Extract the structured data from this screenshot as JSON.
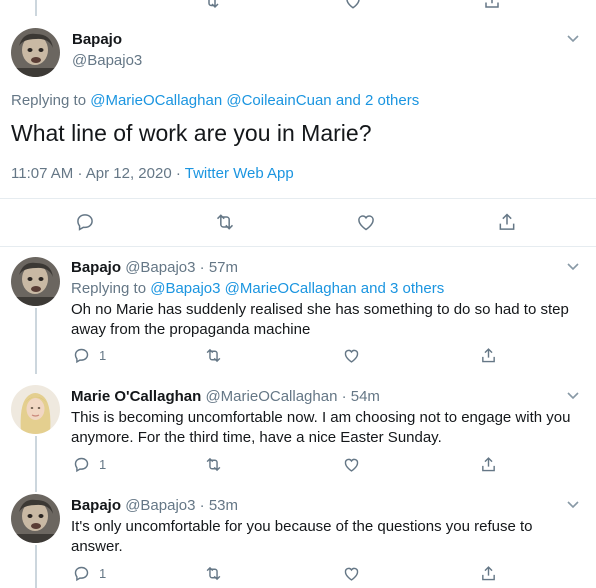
{
  "main_tweet": {
    "name": "Bapajo",
    "handle": "@Bapajo3",
    "replying_prefix": "Replying to",
    "replying_users": [
      "@MarieOCallaghan",
      "@CoileainCuan"
    ],
    "replying_others": "and 2 others",
    "text": "What line of work are you in Marie?",
    "time": "11:07 AM",
    "sep": "·",
    "date": "Apr 12, 2020",
    "source": "Twitter Web App"
  },
  "replies": [
    {
      "name": "Bapajo",
      "handle": "@Bapajo3",
      "time": "57m",
      "replying_prefix": "Replying to",
      "replying_users": [
        "@Bapajo3",
        "@MarieOCallaghan"
      ],
      "replying_others": "and 3 others",
      "text": "Oh no Marie has suddenly realised she has something to do so had to step away from the propaganda machine",
      "reply_count": "1"
    },
    {
      "name": "Marie O'Callaghan",
      "handle": "@MarieOCallaghan",
      "time": "54m",
      "text": "This is becoming uncomfortable now. I am choosing not to engage with you anymore. For the third time, have a nice Easter Sunday.",
      "reply_count": "1"
    },
    {
      "name": "Bapajo",
      "handle": "@Bapajo3",
      "time": "53m",
      "text": "It's only uncomfortable for you because of the questions you refuse to answer.",
      "reply_count": "1"
    }
  ],
  "colors": {
    "accent": "#1b95e0",
    "muted": "#657786",
    "divider": "#e6ecf0"
  }
}
